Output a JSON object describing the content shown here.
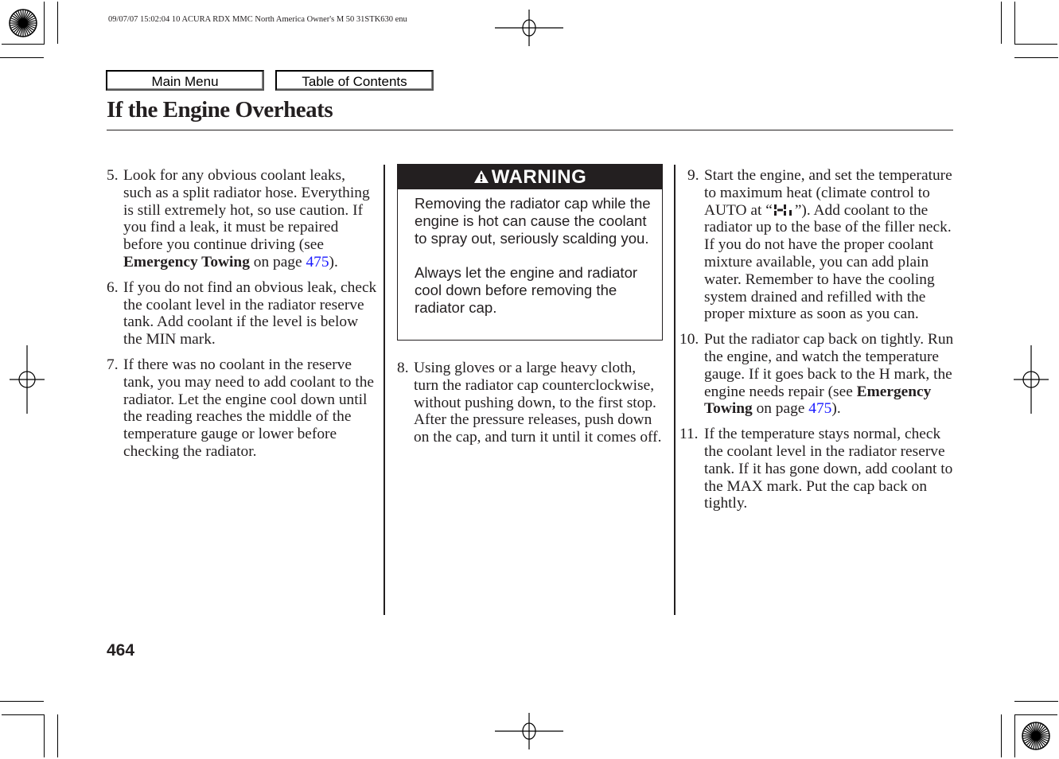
{
  "print_header": "09/07/07 15:02:04    10 ACURA RDX MMC North America Owner's M 50 31STK630 enu",
  "nav": {
    "main_menu": "Main Menu",
    "table_of_contents": "Table of Contents"
  },
  "title": "If the Engine Overheats",
  "column1": {
    "step5": {
      "num": "5.",
      "text_a": "Look for any obvious coolant leaks, such as a split radiator hose. Everything is still extremely hot, so use caution. If you find a leak, it must be repaired before you continue driving (see ",
      "bold": "Emergency Towing",
      "text_b": " on page ",
      "link": "475",
      "text_c": ")."
    },
    "step6": {
      "num": "6.",
      "text": "If you do not find an obvious leak, check the coolant level in the radiator reserve tank. Add coolant if the level is below the MIN mark."
    },
    "step7": {
      "num": "7.",
      "text": "If there was no coolant in the reserve tank, you may need to add coolant to the radiator. Let the engine cool down until the reading reaches the middle of the temperature gauge or lower before checking the radiator."
    }
  },
  "warning": {
    "heading": "WARNING",
    "icon": "warning-triangle-icon",
    "paragraph1": "Removing the radiator cap while the engine is hot can cause the coolant to spray out, seriously scalding you.",
    "paragraph2": "Always let the engine and radiator cool down before removing the radiator cap."
  },
  "column2": {
    "step8": {
      "num": "8.",
      "text": "Using gloves or a large heavy cloth, turn the radiator cap counterclockwise, without pushing down, to the first stop. After the pressure releases, push down on the cap, and turn it until it comes off."
    }
  },
  "column3": {
    "step9": {
      "num": "9.",
      "text_a": "Start the engine, and set the temperature to maximum heat (climate control to AUTO at “",
      "glyph": "Hi-display-icon",
      "text_b": "”). Add coolant to the radiator up to the base of the filler neck. If you do not have the proper coolant mixture available, you can add plain water. Remember to have the cooling system drained and refilled with the proper mixture as soon as you can."
    },
    "step10": {
      "num": "10.",
      "text_a": "Put the radiator cap back on tightly. Run the engine, and watch the temperature gauge. If it goes back to the H mark, the engine needs repair (see ",
      "bold": "Emergency Towing",
      "text_b": " on page ",
      "link": "475",
      "text_c": ")."
    },
    "step11": {
      "num": "11.",
      "text": "If the temperature stays normal, check the coolant level in the radiator reserve tank. If it has gone down, add coolant to the MAX mark. Put the cap back on tightly."
    }
  },
  "page_number": "464",
  "colors": {
    "text": "#231f20",
    "link": "#1a1aff",
    "warning_header_bg": "#231f20"
  }
}
